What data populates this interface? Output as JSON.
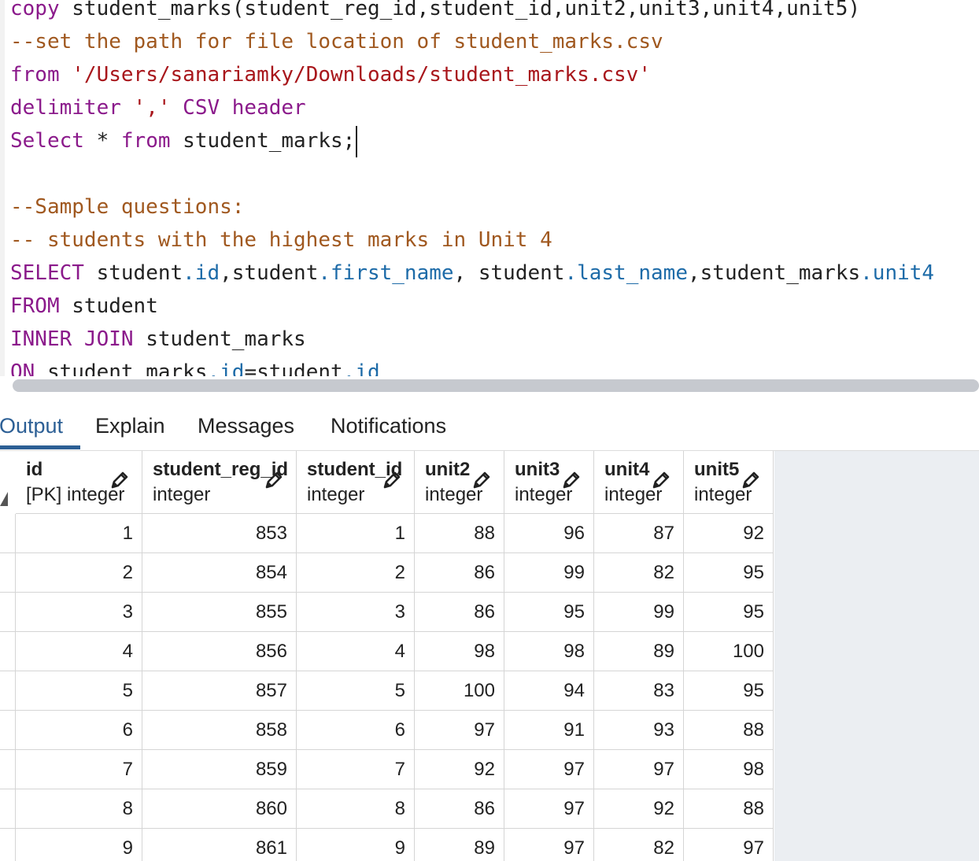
{
  "editor": {
    "lines": [
      [
        {
          "t": "copy",
          "c": "kw"
        },
        {
          "t": " student_marks",
          "c": "pl"
        },
        {
          "t": "(student_reg_id,student_id,unit2,unit3,unit4,unit5)",
          "c": "pl"
        }
      ],
      [
        {
          "t": "--set the path for file location of student_marks.csv",
          "c": "cm"
        }
      ],
      [
        {
          "t": "from",
          "c": "kw"
        },
        {
          "t": " ",
          "c": "pl"
        },
        {
          "t": "'/Users/sanariamky/Downloads/student_marks.csv'",
          "c": "str"
        }
      ],
      [
        {
          "t": "delimiter",
          "c": "kw"
        },
        {
          "t": " ",
          "c": "pl"
        },
        {
          "t": "','",
          "c": "str"
        },
        {
          "t": " CSV header",
          "c": "kw"
        }
      ],
      [
        {
          "t": "Select",
          "c": "kw"
        },
        {
          "t": " * ",
          "c": "pl"
        },
        {
          "t": "from",
          "c": "kw"
        },
        {
          "t": " student_marks;",
          "c": "pl"
        }
      ],
      [],
      [
        {
          "t": "--Sample questions:",
          "c": "cm"
        }
      ],
      [
        {
          "t": "-- students with the highest marks in Unit 4",
          "c": "cm"
        }
      ],
      [
        {
          "t": "SELECT",
          "c": "kw"
        },
        {
          "t": " student",
          "c": "pl"
        },
        {
          "t": ".id",
          "c": "prop"
        },
        {
          "t": ",student",
          "c": "pl"
        },
        {
          "t": ".first_name",
          "c": "prop"
        },
        {
          "t": ", student",
          "c": "pl"
        },
        {
          "t": ".last_name",
          "c": "prop"
        },
        {
          "t": ",student_marks",
          "c": "pl"
        },
        {
          "t": ".unit4",
          "c": "prop"
        }
      ],
      [
        {
          "t": "FROM",
          "c": "kw"
        },
        {
          "t": " student",
          "c": "pl"
        }
      ],
      [
        {
          "t": "INNER JOIN",
          "c": "kw"
        },
        {
          "t": " student_marks",
          "c": "pl"
        }
      ],
      [
        {
          "t": "ON",
          "c": "kw"
        },
        {
          "t": " student_marks",
          "c": "pl"
        },
        {
          "t": ".id",
          "c": "prop"
        },
        {
          "t": "=student",
          "c": "pl"
        },
        {
          "t": ".id",
          "c": "prop"
        }
      ]
    ],
    "cursor_line": 4
  },
  "tabs": [
    {
      "label": "Output",
      "active": true
    },
    {
      "label": "Explain",
      "active": false
    },
    {
      "label": "Messages",
      "active": false
    },
    {
      "label": "Notifications",
      "active": false
    }
  ],
  "columns": [
    {
      "name": "id",
      "type": "[PK] integer"
    },
    {
      "name": "student_reg_id",
      "type": "integer"
    },
    {
      "name": "student_id",
      "type": "integer"
    },
    {
      "name": "unit2",
      "type": "integer"
    },
    {
      "name": "unit3",
      "type": "integer"
    },
    {
      "name": "unit4",
      "type": "integer"
    },
    {
      "name": "unit5",
      "type": "integer"
    }
  ],
  "rows": [
    [
      "1",
      "853",
      "1",
      "88",
      "96",
      "87",
      "92"
    ],
    [
      "2",
      "854",
      "2",
      "86",
      "99",
      "82",
      "95"
    ],
    [
      "3",
      "855",
      "3",
      "86",
      "95",
      "99",
      "95"
    ],
    [
      "4",
      "856",
      "4",
      "98",
      "98",
      "89",
      "100"
    ],
    [
      "5",
      "857",
      "5",
      "100",
      "94",
      "83",
      "95"
    ],
    [
      "6",
      "858",
      "6",
      "97",
      "91",
      "93",
      "88"
    ],
    [
      "7",
      "859",
      "7",
      "92",
      "97",
      "97",
      "98"
    ],
    [
      "8",
      "860",
      "8",
      "86",
      "97",
      "92",
      "88"
    ],
    [
      "9",
      "861",
      "9",
      "89",
      "97",
      "82",
      "97"
    ]
  ],
  "colors": {
    "keyword": "#8b1a8b",
    "comment": "#a0581f",
    "string": "#a8161b",
    "property": "#1d6ba8",
    "accent": "#2c5f95"
  },
  "icons": {
    "column_edit": "pencil-icon"
  }
}
